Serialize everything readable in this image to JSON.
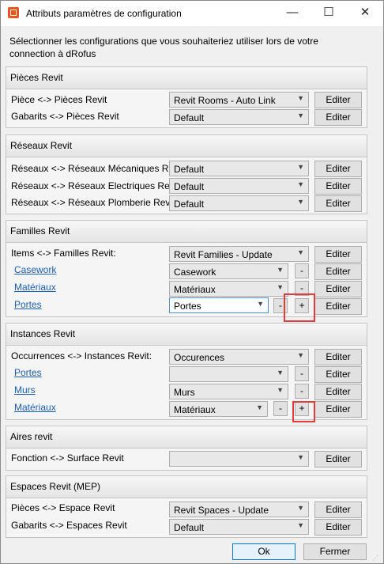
{
  "window": {
    "title": "Attributs paramètres de configuration",
    "minimize": "—",
    "maximize": "☐",
    "close": "✕"
  },
  "intro": "Sélectionner les configurations que vous souhaiteriez utiliser lors de votre connection à dRofus",
  "edit_label": "Editer",
  "minus_label": "-",
  "plus_label": "+",
  "panels": {
    "pieces": {
      "header": "Pièces Revit",
      "rows": [
        {
          "label": "Pièce <-> Pièces Revit",
          "value": "Revit Rooms - Auto Link"
        },
        {
          "label": "Gabarits <-> Pièces Revit",
          "value": "Default"
        }
      ]
    },
    "reseaux": {
      "header": "Réseaux Revit",
      "rows": [
        {
          "label": "Réseaux <-> Réseaux Mécaniques Revit",
          "value": "Default"
        },
        {
          "label": "Réseaux <-> Réseaux Electriques Revit",
          "value": "Default"
        },
        {
          "label": "Réseaux <-> Réseaux Plomberie Revit",
          "value": "Default"
        }
      ]
    },
    "familles": {
      "header": "Familles Revit",
      "rows": [
        {
          "label": "Items <-> Familles Revit:",
          "value": "Revit Families - Update"
        },
        {
          "label": "Casework",
          "value": "Casework"
        },
        {
          "label": "Matériaux",
          "value": "Matériaux"
        },
        {
          "label": "Portes",
          "value": "Portes"
        }
      ]
    },
    "instances": {
      "header": "Instances Revit",
      "rows": [
        {
          "label": "Occurrences <-> Instances Revit:",
          "value": "Occurences"
        },
        {
          "label": "Portes",
          "value": ""
        },
        {
          "label": "Murs",
          "value": "Murs"
        },
        {
          "label": "Matériaux",
          "value": "Matériaux"
        }
      ]
    },
    "aires": {
      "header": "Aires revit",
      "rows": [
        {
          "label": "Fonction <-> Surface Revit",
          "value": ""
        }
      ]
    },
    "espaces": {
      "header": "Espaces Revit (MEP)",
      "rows": [
        {
          "label": "Pièces <-> Espace Revit",
          "value": "Revit Spaces - Update"
        },
        {
          "label": "Gabarits <-> Espaces Revit",
          "value": "Default"
        }
      ]
    }
  },
  "footer": {
    "ok": "Ok",
    "close": "Fermer"
  },
  "colors": {
    "highlight": "#e03c3c",
    "link": "#1a5fb4",
    "accent": "#0078d7"
  }
}
